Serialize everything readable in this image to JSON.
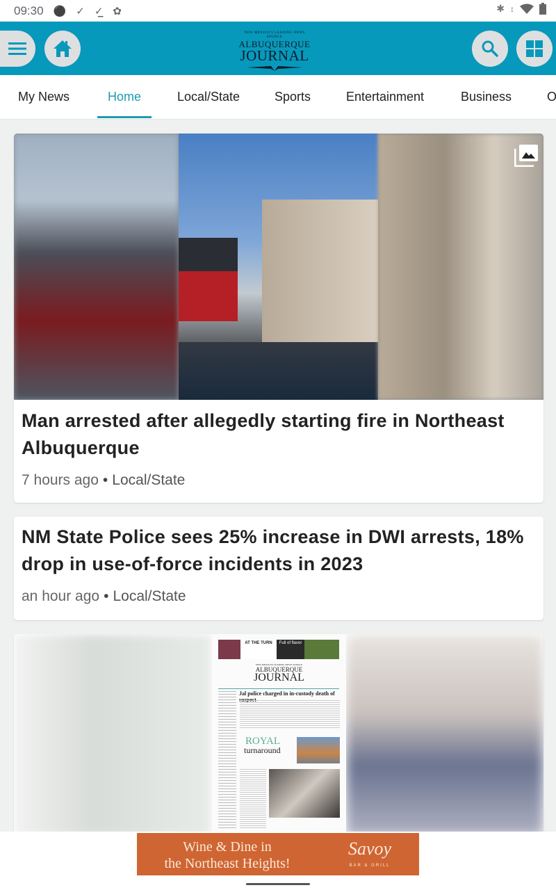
{
  "status_bar": {
    "time": "09:30",
    "left_icons": [
      "keyhole-icon",
      "check-icon",
      "download-done-icon",
      "fan-icon"
    ],
    "right_icons": [
      "bluetooth-icon",
      "data-arrows-icon",
      "wifi-icon",
      "battery-icon"
    ]
  },
  "app_bar": {
    "logo": {
      "tagline": "NEW MEXICO'S LEADING NEWS SOURCE",
      "line1": "ALBUQUERQUE",
      "line2": "JOURNAL"
    },
    "buttons": [
      "menu-icon",
      "home-icon",
      "search-icon",
      "grid-icon"
    ],
    "accent_color": "#0799bb"
  },
  "tabs": [
    {
      "label": "My News",
      "active": false
    },
    {
      "label": "Home",
      "active": true
    },
    {
      "label": "Local/State",
      "active": false
    },
    {
      "label": "Sports",
      "active": false
    },
    {
      "label": "Entertainment",
      "active": false
    },
    {
      "label": "Business",
      "active": false
    },
    {
      "label": "O",
      "active": false
    }
  ],
  "articles": [
    {
      "headline": "Man arrested after allegedly starting fire in Northeast Albuquerque",
      "time": "7 hours ago",
      "category": "Local/State",
      "has_gallery": true
    },
    {
      "headline": "NM State Police sees 25% increase in DWI arrests, 18% drop in use-of-force incidents in 2023",
      "time": "an hour ago",
      "category": "Local/State"
    }
  ],
  "eedition": {
    "top_left": "AT THE TURN",
    "top_mid": "Full of flavor",
    "tagline": "NEW MEXICO'S LEADING NEWS SOURCE",
    "line1": "ALBUQUERQUE",
    "line2": "JOURNAL",
    "headline": "Jal police charged in in-custody death of suspect",
    "feature_title": "ROYAL",
    "feature_sub": "turnaround"
  },
  "ad": {
    "text_line1": "Wine & Dine in",
    "text_line2": "the Northeast Heights!",
    "brand": "Savoy",
    "brand_sub": "BAR & GRILL",
    "color": "#cf6532"
  },
  "separator": "•"
}
